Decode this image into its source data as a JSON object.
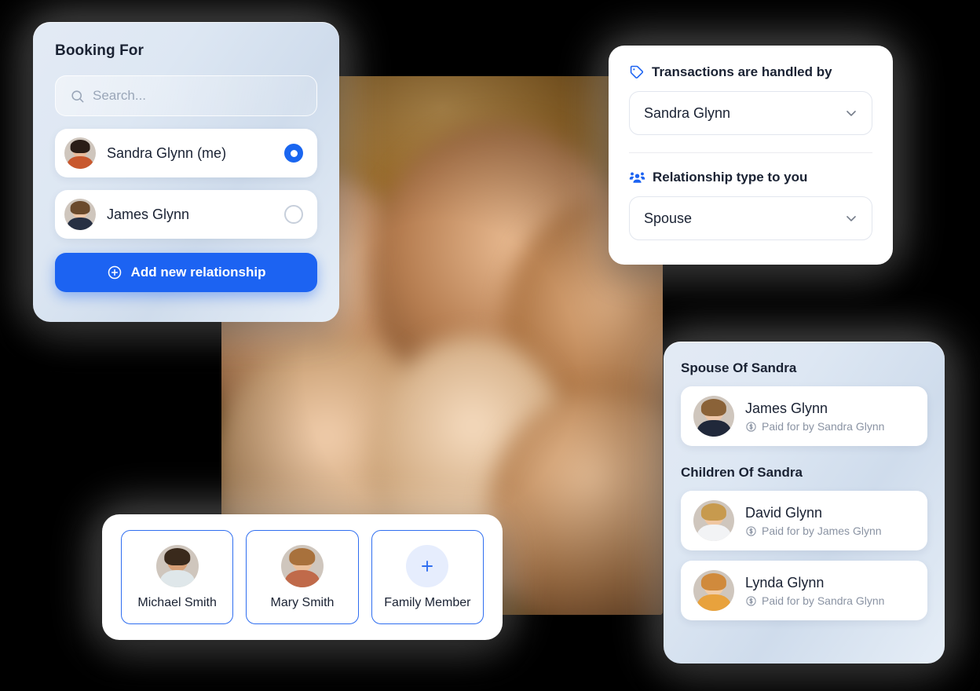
{
  "booking": {
    "title": "Booking For",
    "search": {
      "placeholder": "Search...",
      "value": "",
      "icon": "search-icon"
    },
    "people": [
      {
        "name": "Sandra Glynn (me)",
        "selected": true
      },
      {
        "name": "James Glynn",
        "selected": false
      }
    ],
    "add_button": {
      "label": "Add new relationship",
      "icon": "plus-circle-icon"
    }
  },
  "transactions": {
    "handled_by": {
      "icon": "tag-icon",
      "label": "Transactions are handled by",
      "value": "Sandra Glynn",
      "chevron": "chevron-down-icon"
    },
    "relationship_type": {
      "icon": "people-group-icon",
      "label": "Relationship type to you",
      "value": "Spouse",
      "chevron": "chevron-down-icon"
    }
  },
  "relationships": {
    "groups": [
      {
        "title": "Spouse Of Sandra",
        "members": [
          {
            "name": "James Glynn",
            "paid_by": "Paid for by Sandra Glynn",
            "icon": "dollar-circle-icon"
          }
        ]
      },
      {
        "title": "Children Of Sandra",
        "members": [
          {
            "name": "David Glynn",
            "paid_by": "Paid for by James Glynn",
            "icon": "dollar-circle-icon"
          },
          {
            "name": "Lynda Glynn",
            "paid_by": "Paid for by Sandra Glynn",
            "icon": "dollar-circle-icon"
          }
        ]
      }
    ]
  },
  "family": {
    "cards": [
      {
        "name": "Michael Smith",
        "type": "person"
      },
      {
        "name": "Mary Smith",
        "type": "person"
      },
      {
        "name": "Family Member",
        "type": "add",
        "icon": "plus-icon"
      }
    ]
  },
  "colors": {
    "accent_blue": "#1c63f2",
    "card_border_blue": "#2f6ef0",
    "text_dark": "#1a2233",
    "text_muted": "#8a93a3",
    "placeholder": "#9aa6b8"
  }
}
